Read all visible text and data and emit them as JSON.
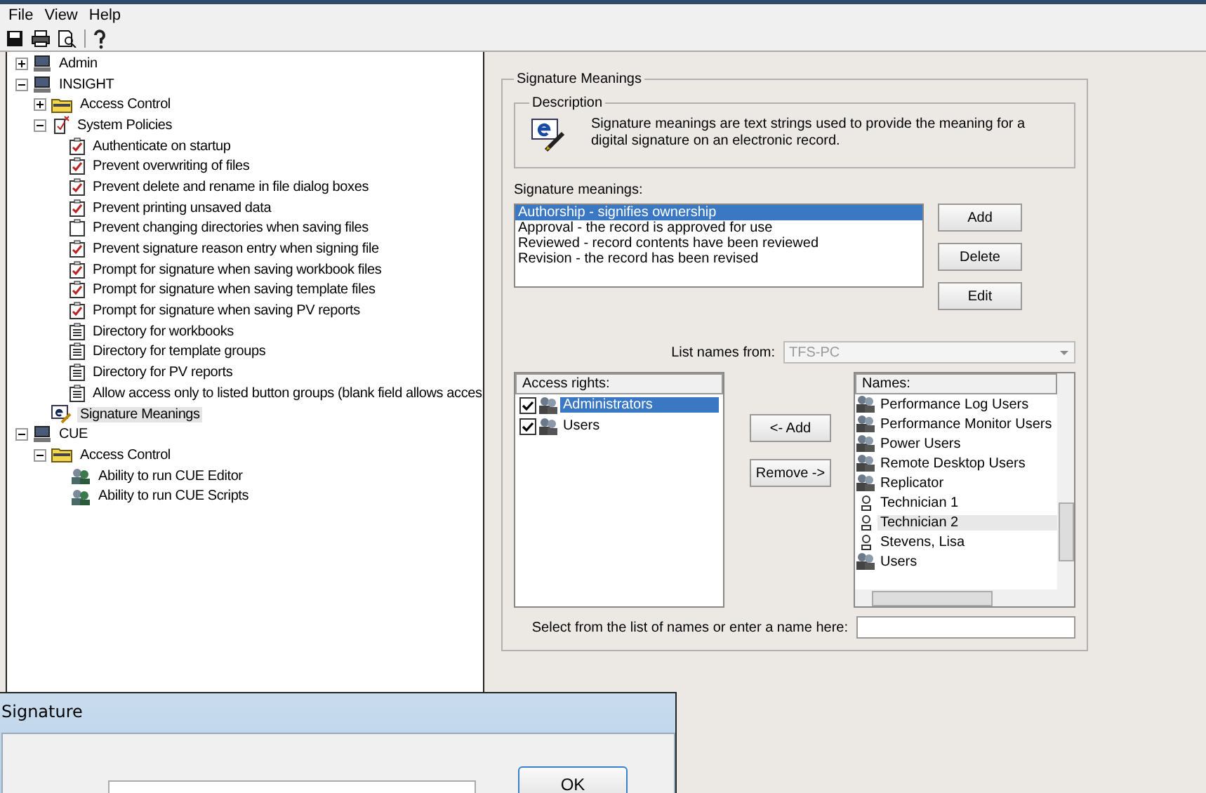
{
  "menu": [
    "File",
    "View",
    "Help"
  ],
  "tree": [
    {
      "label": "Admin",
      "kind": "computer",
      "expanded": false,
      "selected": false
    },
    {
      "label": "INSIGHT",
      "kind": "computer",
      "expanded": true,
      "selected": false,
      "children": [
        {
          "label": "Access Control",
          "kind": "folder",
          "expanded": false,
          "selected": false
        },
        {
          "label": "System Policies",
          "kind": "policies",
          "expanded": true,
          "selected": false,
          "children": [
            {
              "label": "Authenticate on startup",
              "kind": "policy",
              "checked": true,
              "selected": false
            },
            {
              "label": "Prevent overwriting of files",
              "kind": "policy",
              "checked": true,
              "selected": false
            },
            {
              "label": "Prevent delete and rename in file dialog boxes",
              "kind": "policy",
              "checked": true,
              "selected": false
            },
            {
              "label": "Prevent printing unsaved data",
              "kind": "policy",
              "checked": true,
              "selected": false
            },
            {
              "label": "Prevent changing directories when saving files",
              "kind": "policy",
              "checked": false,
              "selected": false
            },
            {
              "label": "Prevent signature reason entry when signing file",
              "kind": "policy",
              "checked": true,
              "selected": false
            },
            {
              "label": "Prompt for signature when saving workbook files",
              "kind": "policy",
              "checked": true,
              "selected": false
            },
            {
              "label": "Prompt for signature when saving template files",
              "kind": "policy",
              "checked": true,
              "selected": false
            },
            {
              "label": "Prompt for signature when saving PV reports",
              "kind": "policy",
              "checked": true,
              "selected": false
            },
            {
              "label": "Directory for workbooks",
              "kind": "setting",
              "selected": false
            },
            {
              "label": "Directory for template groups",
              "kind": "setting",
              "selected": false
            },
            {
              "label": "Directory for PV reports",
              "kind": "setting",
              "selected": false
            },
            {
              "label": "Allow access only to listed button groups (blank field allows acces",
              "kind": "setting",
              "selected": false
            }
          ]
        },
        {
          "label": "Signature Meanings",
          "kind": "signature",
          "selected": true
        }
      ]
    },
    {
      "label": "CUE",
      "kind": "computer",
      "expanded": true,
      "selected": false,
      "children": [
        {
          "label": "Access Control",
          "kind": "folder",
          "expanded": true,
          "selected": false,
          "children": [
            {
              "label": "Ability to run CUE Editor",
              "kind": "users",
              "selected": false
            },
            {
              "label": "Ability to run CUE Scripts",
              "kind": "users",
              "selected": false
            }
          ]
        }
      ]
    }
  ],
  "panel": {
    "title": "Signature Meanings",
    "description_title": "Description",
    "description": "Signature meanings are text strings used to provide the meaning for a digital signature on an electronic record.",
    "meanings_label": "Signature meanings:",
    "meanings": [
      {
        "text": "Authorship - signifies ownership",
        "selected": true
      },
      {
        "text": "Approval - the record is approved for use",
        "selected": false
      },
      {
        "text": "Reviewed - record contents have been reviewed",
        "selected": false
      },
      {
        "text": "Revision - the record has been revised",
        "selected": false
      }
    ],
    "meaning_buttons": [
      "Add",
      "Delete",
      "Edit"
    ],
    "list_names_label": "List names from:",
    "list_names_value": "TFS-PC",
    "access_rights_header": "Access rights:",
    "access_rights": [
      {
        "name": "Administrators",
        "checked": true,
        "selected": true
      },
      {
        "name": "Users",
        "checked": true,
        "selected": false
      }
    ],
    "add_button": "<- Add",
    "remove_button": "Remove ->",
    "names_header": "Names:",
    "names": [
      {
        "name": "Performance Log Users",
        "kind": "group",
        "selected": false
      },
      {
        "name": "Performance Monitor Users",
        "kind": "group",
        "selected": false
      },
      {
        "name": "Power Users",
        "kind": "group",
        "selected": false
      },
      {
        "name": "Remote Desktop Users",
        "kind": "group",
        "selected": false
      },
      {
        "name": "Replicator",
        "kind": "group",
        "selected": false
      },
      {
        "name": "Technician 1",
        "kind": "user",
        "selected": false
      },
      {
        "name": "Technician 2",
        "kind": "user",
        "selected": true
      },
      {
        "name": "Stevens, Lisa",
        "kind": "user",
        "selected": false
      },
      {
        "name": "Users",
        "kind": "group",
        "selected": false
      }
    ],
    "name_entry_label": "Select from the list of names or enter a name here:"
  },
  "dialog": {
    "title": "Signature",
    "ok_button": "OK"
  }
}
